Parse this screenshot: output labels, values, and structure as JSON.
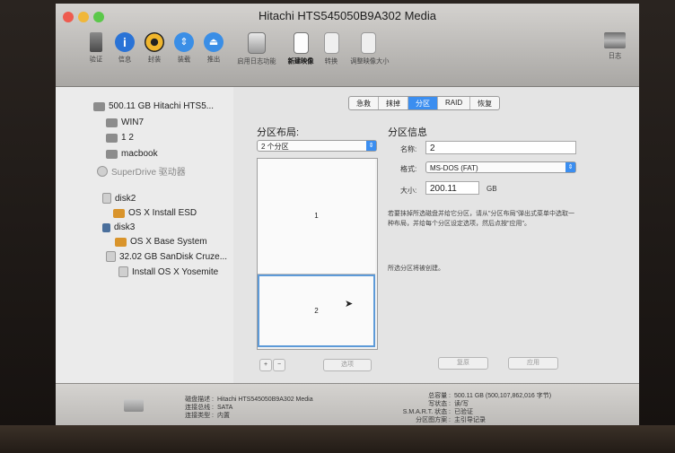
{
  "window": {
    "title": "Hitachi HTS545050B9A302 Media"
  },
  "toolbar": {
    "items": [
      {
        "label": "验证",
        "icon": "microscope-icon"
      },
      {
        "label": "信息",
        "icon": "info-icon"
      },
      {
        "label": "封装",
        "icon": "burn-icon"
      },
      {
        "label": "装载",
        "icon": "mount-icon"
      },
      {
        "label": "推出",
        "icon": "eject-icon"
      },
      {
        "label": "启用日志功能",
        "icon": "enable-journaling-icon"
      },
      {
        "label": "新建映像",
        "icon": "new-image-icon"
      },
      {
        "label": "转换",
        "icon": "convert-icon"
      },
      {
        "label": "调整映像大小",
        "icon": "resize-image-icon"
      },
      {
        "label": "日志",
        "icon": "log-icon"
      }
    ]
  },
  "sidebar": {
    "items": [
      {
        "label": "500.11 GB Hitachi HTS5..."
      },
      {
        "label": "WIN7"
      },
      {
        "label": "1 2"
      },
      {
        "label": "macbook"
      },
      {
        "label": "SuperDrive 驱动器"
      },
      {
        "label": "disk2"
      },
      {
        "label": "OS X Install ESD"
      },
      {
        "label": "disk3"
      },
      {
        "label": "OS X Base System"
      },
      {
        "label": "32.02 GB SanDisk Cruze..."
      },
      {
        "label": "Install OS X Yosemite"
      }
    ]
  },
  "tabs": [
    "急救",
    "抹掉",
    "分区",
    "RAID",
    "恢复"
  ],
  "layout": {
    "heading": "分区布局:",
    "popup_value": "2 个分区",
    "partitions": [
      "1",
      "2"
    ],
    "add_label": "+",
    "remove_label": "−",
    "options_label": "选项"
  },
  "info": {
    "heading": "分区信息",
    "name_label": "名称:",
    "name_value": "2",
    "format_label": "格式:",
    "format_value": "MS-DOS (FAT)",
    "size_label": "大小:",
    "size_value": "200.11",
    "size_unit": "GB",
    "description": "若要抹掉所选磁盘并给它分区，请从\"分区布局\"弹出式菜单中选取一种布局，并给每个分区设定选项，然后点按\"应用\"。",
    "pending_note": "所选分区将被创建。",
    "revert_label": "复原",
    "apply_label": "应用"
  },
  "footer": {
    "desc_label": "磁盘描述 :",
    "desc_value": "Hitachi HTS545050B9A302 Media",
    "bus_label": "连接总线 :",
    "bus_value": "SATA",
    "type_label": "连接类型 :",
    "type_value": "内置",
    "capacity_label": "总容量 :",
    "capacity_value": "500.11 GB (500,107,862,016 字节)",
    "write_label": "写状态 :",
    "write_value": "读/写",
    "smart_label": "S.M.A.R.T. 状态 :",
    "smart_value": "已验证",
    "scheme_label": "分区图方案 :",
    "scheme_value": "主引导记录"
  },
  "colors": {
    "accent": "#3b8ef0",
    "close": "#ee5b4f",
    "minimize": "#f0b73a",
    "zoom": "#5bc84a"
  }
}
